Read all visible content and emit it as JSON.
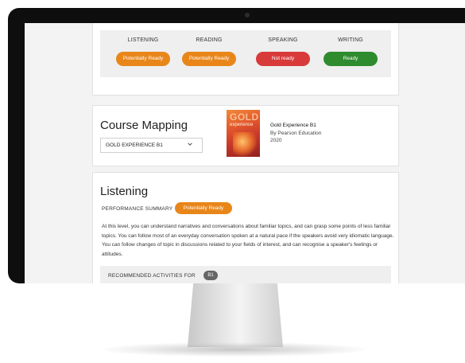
{
  "skills": [
    {
      "name": "LISTENING",
      "status": "Potentially Ready",
      "color": "#e8861a"
    },
    {
      "name": "READING",
      "status": "Potentially Ready",
      "color": "#e8861a"
    },
    {
      "name": "SPEAKING",
      "status": "Not ready",
      "color": "#d83a3a"
    },
    {
      "name": "WRITING",
      "status": "Ready",
      "color": "#2e8b2e"
    }
  ],
  "course_mapping": {
    "title": "Course Mapping",
    "selected_course": "GOLD EXPERIENCE B1",
    "book": {
      "cover_title": "GOLD",
      "cover_subtitle": "experience",
      "title": "Gold Experience B1",
      "publisher": "By Pearson Education",
      "year": "2020"
    }
  },
  "listening": {
    "title": "Listening",
    "performance_label": "PERFORMANCE SUMMARY",
    "performance_status": "Potentially Ready",
    "performance_color": "#e8861a",
    "summary": "At this level, you can understand narratives and conversations about familiar topics, and can grasp some points of less familiar topics. You can follow most of an everyday conversation spoken at a natural pace if the speakers avoid very idiomatic language. You can follow changes of topic in discussions related to your fields of interest, and can recognise a speaker's feelings or attitudes.",
    "recommended_label": "RECOMMENDED ACTIVITIES FOR",
    "recommended_level": "B1"
  },
  "icons": {
    "dropdown": "chevron-down-icon"
  }
}
